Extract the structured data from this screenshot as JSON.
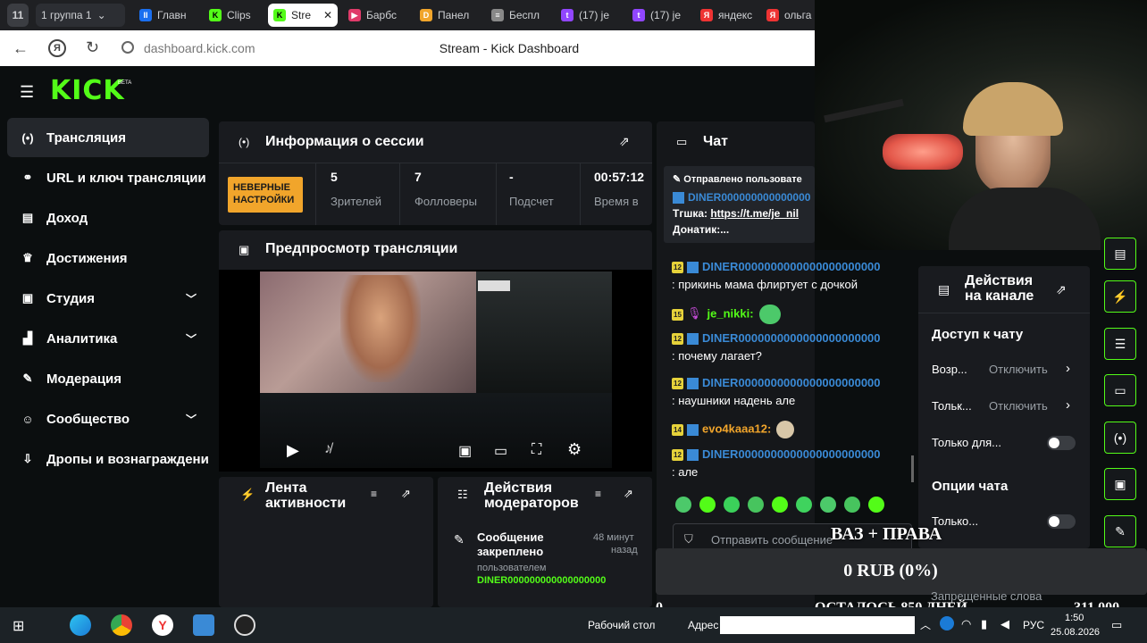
{
  "browser": {
    "tab_count": "11",
    "tabs": [
      {
        "label": "1  группа 1",
        "color": "#444"
      },
      {
        "label": "Главн",
        "color": "#1a6ff0"
      },
      {
        "label": "Clips",
        "color": "#53fc18"
      },
      {
        "label": "Stre",
        "color": "#53fc18"
      },
      {
        "label": "Барбс",
        "color": "#e03b6a"
      },
      {
        "label": "Панел",
        "color": "#f1a52b"
      },
      {
        "label": "Беспл",
        "color": "#888"
      },
      {
        "label": "(17) je",
        "color": "#9146ff"
      },
      {
        "label": "(17) je",
        "color": "#9146ff"
      },
      {
        "label": "яндекс",
        "color": "#e33"
      },
      {
        "label": "ольга",
        "color": "#e33"
      }
    ],
    "url": "dashboard.kick.com",
    "page_title": "Stream - Kick Dashboard"
  },
  "brand": {
    "logo": "KICK",
    "beta": "BETA",
    "accent": "#53fc18"
  },
  "sidebar": {
    "items": [
      {
        "label": "Трансляция",
        "icon": "broadcast-icon",
        "glyph": "(•)"
      },
      {
        "label": "URL и ключ трансляции",
        "icon": "link-icon",
        "glyph": "⚭"
      },
      {
        "label": "Доход",
        "icon": "chart-icon",
        "glyph": "▤"
      },
      {
        "label": "Достижения",
        "icon": "trophy-icon",
        "glyph": "♛"
      },
      {
        "label": "Студия",
        "icon": "studio-icon",
        "glyph": "▣"
      },
      {
        "label": "Аналитика",
        "icon": "analytics-icon",
        "glyph": "▟"
      },
      {
        "label": "Модерация",
        "icon": "wrench-icon",
        "glyph": "✎"
      },
      {
        "label": "Сообщество",
        "icon": "community-icon",
        "glyph": "☺"
      },
      {
        "label": "Дропы и вознаграждени",
        "icon": "drops-icon",
        "glyph": "⇩"
      }
    ]
  },
  "session": {
    "title": "Информация о сессии",
    "warning": "НЕВЕРНЫЕ НАСТРОЙКИ",
    "stats": [
      {
        "value": "5",
        "label": "Зрителей"
      },
      {
        "value": "7",
        "label": "Фолловеры"
      },
      {
        "value": "-",
        "label": "Подсчет"
      },
      {
        "value": "00:57:12",
        "label": "Время в"
      }
    ]
  },
  "preview": {
    "title": "Предпросмотр трансляции"
  },
  "activity": {
    "title1": "Лента",
    "title2": "активности"
  },
  "modactions": {
    "title1": "Действия",
    "title2": "модераторов",
    "item_title1": "Сообщение",
    "item_title2": "закреплено",
    "time1": "48 минут",
    "time2": "назад",
    "by": "пользователем",
    "user": "DINER000000000000000000"
  },
  "chat": {
    "title": "Чат",
    "pinned_label": "Отправлено пользовате",
    "pinned_user": "DINER000000000000000",
    "pinned_line1_prefix": "Тгшка: ",
    "pinned_link": "https://t.me/je_nil",
    "pinned_line2": "Донатик:...",
    "messages": [
      {
        "badge": "12",
        "user": "DINER0000000000000000000000",
        "color": "#3a8ad6",
        "text": ": прикинь мама флиртует с дочкой"
      },
      {
        "badge": "15",
        "user": "je_nikki:",
        "color": "#53fc18",
        "text": ""
      },
      {
        "badge": "12",
        "user": "DINER0000000000000000000000",
        "color": "#3a8ad6",
        "text": ": почему лагает?"
      },
      {
        "badge": "12",
        "user": "DINER0000000000000000000000",
        "color": "#3a8ad6",
        "text": ": наушники надень але"
      },
      {
        "badge": "14",
        "user": "evo4kaaa12:",
        "color": "#f1a52b",
        "text": ""
      },
      {
        "badge": "12",
        "user": "DINER0000000000000000000000",
        "color": "#3a8ad6",
        "text": ": але"
      }
    ],
    "input_placeholder": "Отправить сообщение"
  },
  "channel_actions": {
    "title1": "Действия",
    "title2": "на канале",
    "chat_access": "Доступ к чату",
    "rows": [
      {
        "label": "Возр...",
        "value": "Отключить"
      },
      {
        "label": "Тольк...",
        "value": "Отключить"
      }
    ],
    "followers_only": "Только для...",
    "chat_options": "Опции чата",
    "only2": "Только...",
    "banned_words": "Запрещенные слова"
  },
  "overlay": {
    "vaz": "ВАЗ + ПРАВА",
    "rub": "0 RUB (0%)",
    "days_left": "ОСТАЛОСЬ 850 ДНЕЙ",
    "goal": "311 000",
    "zero": "0"
  },
  "taskbar": {
    "desktop": "Рабочий стол",
    "address": "Адрес",
    "lang": "РУС",
    "time": "1:50",
    "date": "25.08.2026"
  }
}
